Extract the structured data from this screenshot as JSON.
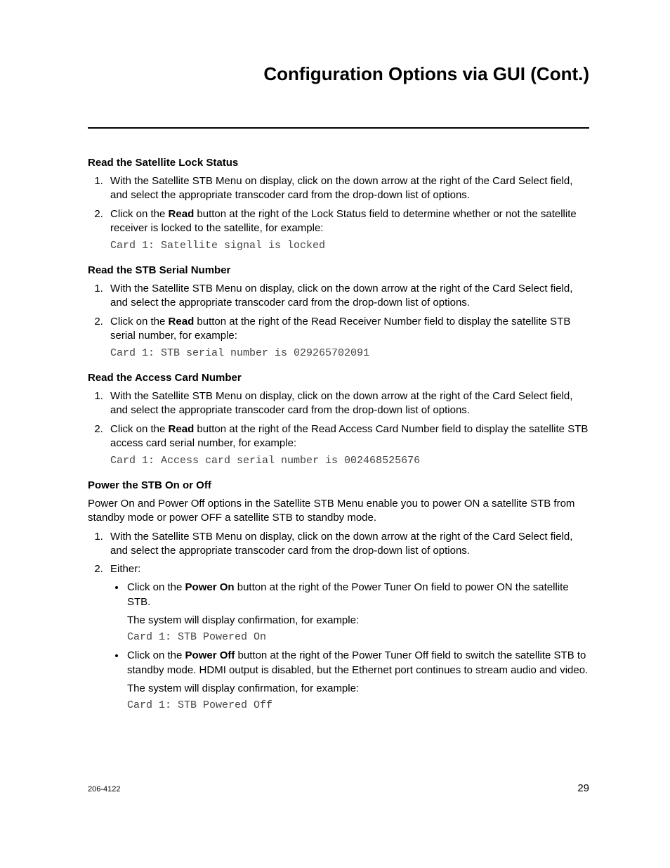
{
  "title": "Configuration Options via GUI (Cont.)",
  "sections": {
    "lockStatus": {
      "heading": "Read the Satellite Lock Status",
      "step1": "With the Satellite STB Menu on display, click on the down arrow at the right of the Card Select field, and select the appropriate transcoder card from the drop-down list of options.",
      "step2a": "Click on the ",
      "step2b": "Read",
      "step2c": " button at the right of the Lock Status field to determine whether or not the satellite receiver is locked to the satellite, for example:",
      "code": "Card 1: Satellite signal is locked"
    },
    "serial": {
      "heading": "Read the STB Serial Number",
      "step1": "With the Satellite STB Menu on display, click on the down arrow at the right of the Card Select field, and select the appropriate transcoder card from the drop-down list of options.",
      "step2a": "Click on the ",
      "step2b": "Read",
      "step2c": " button at the right of the Read Receiver Number field to display the satellite STB serial number, for example:",
      "code": "Card 1: STB serial number is 029265702091"
    },
    "accessCard": {
      "heading": "Read the Access Card Number",
      "step1": "With the Satellite STB Menu on display, click on the down arrow at the right of the Card Select field, and select the appropriate transcoder card from the drop-down list of options.",
      "step2a": "Click on the ",
      "step2b": "Read",
      "step2c": " button at the right of the Read Access Card Number field to display the satellite STB access card serial number, for example:",
      "code": "Card 1: Access card serial number is 002468525676"
    },
    "power": {
      "heading": "Power the STB On or Off",
      "intro": "Power On and Power Off options in the Satellite STB Menu enable you to power ON a satellite STB from standby mode or power OFF a satellite STB to standby mode.",
      "step1": "With the Satellite STB Menu on display, click on the down arrow at the right of the Card Select field, and select the appropriate transcoder card from the drop-down list of options.",
      "step2": "Either:",
      "bullet1a": "Click on the ",
      "bullet1b": "Power On",
      "bullet1c": " button at the right of the Power Tuner On field to power ON the satellite STB.",
      "confirm1": "The system will display confirmation, for example:",
      "code1": "Card 1: STB Powered On",
      "bullet2a": "Click on the ",
      "bullet2b": "Power Off",
      "bullet2c": " button at the right of the Power Tuner Off field to switch the satellite STB to standby mode. HDMI output is disabled, but the Ethernet port continues to stream audio and video.",
      "confirm2": "The system will display confirmation, for example:",
      "code2": "Card 1: STB Powered Off"
    }
  },
  "footer": {
    "docnum": "206-4122",
    "page": "29"
  }
}
